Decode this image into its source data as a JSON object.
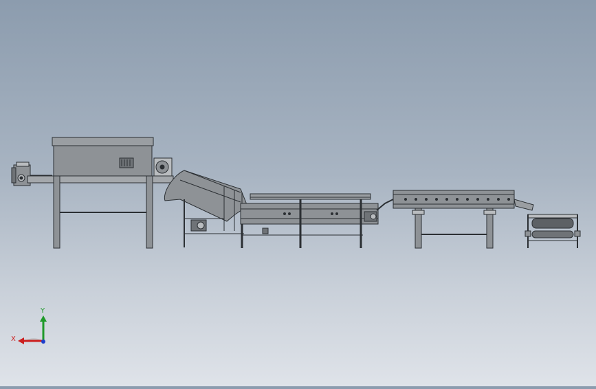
{
  "viewport": {
    "background_top": "#8c9cae",
    "background_bottom": "#dfe3e9"
  },
  "colors": {
    "line": "#2b2f33",
    "metal": "#8e9296",
    "metal_dark": "#6f7377",
    "metal_light": "#b9bcbf",
    "axis_x": "#cc1f1f",
    "axis_y": "#1f9a2a",
    "axis_z": "#1f3fcc"
  },
  "triad": {
    "x_label": "X",
    "y_label": "Y"
  },
  "machines": [
    {
      "name": "feed-motor"
    },
    {
      "name": "drying-oven"
    },
    {
      "name": "inclined-conveyor"
    },
    {
      "name": "fryer-tank"
    },
    {
      "name": "cooling-conveyor"
    },
    {
      "name": "roller-unit"
    }
  ]
}
